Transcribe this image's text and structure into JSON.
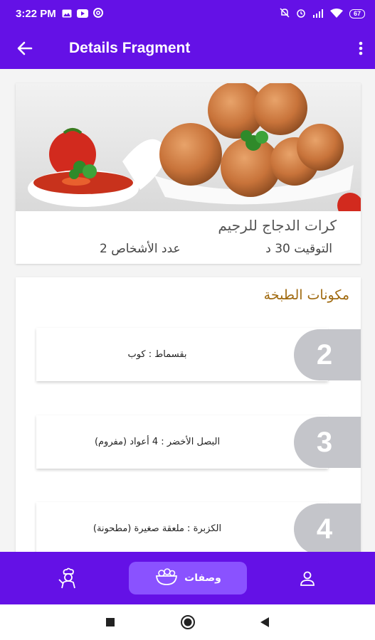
{
  "status_bar": {
    "time": "3:22 PM",
    "battery": "67",
    "left_icons": [
      "gallery-icon",
      "youtube-icon",
      "at-icon"
    ],
    "right_icons": [
      "mute-icon",
      "alarm-icon",
      "signal-icon",
      "wifi-icon",
      "battery-icon"
    ]
  },
  "app_bar": {
    "title": "Details Fragment",
    "back_icon": "arrow-left-icon",
    "menu_icon": "more-vert-icon",
    "color": "#6411e6"
  },
  "recipe": {
    "name": "كرات الدجاج للرجيم",
    "time_label": "التوقيت 30 د",
    "people_label": "عدد الأشخاص 2"
  },
  "ingredients": {
    "heading": "مكونات الطبخة",
    "heading_color": "#a06a10",
    "items": [
      {
        "number": "2",
        "text": "بقسماط : كوب"
      },
      {
        "number": "3",
        "text": "البصل الأخضر : 4 أعواد (مفروم)"
      },
      {
        "number": "4",
        "text": "الكزبرة : ملعقة صغيرة (مطحونة)"
      }
    ]
  },
  "bottom_nav": {
    "items": [
      {
        "icon": "chef-icon",
        "label": ""
      },
      {
        "icon": "salad-bowl-icon",
        "label": "وصفات",
        "active": true
      },
      {
        "icon": "person-icon",
        "label": ""
      }
    ],
    "active_color": "#8a52ff"
  },
  "system_nav": {
    "icons": [
      "square-icon",
      "circle-icon",
      "triangle-back-icon"
    ]
  }
}
